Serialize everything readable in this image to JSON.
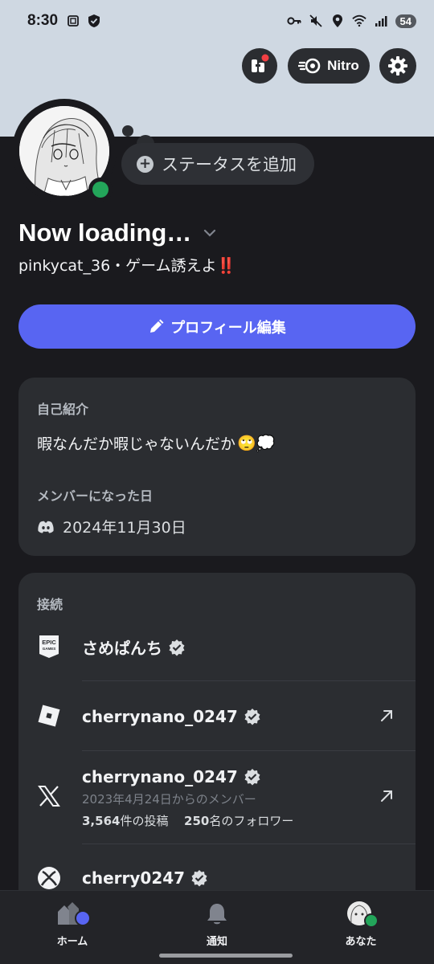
{
  "status_bar": {
    "time": "8:30",
    "battery": "54"
  },
  "header": {
    "nitro_label": "Nitro",
    "status_placeholder": "ステータスを追加"
  },
  "profile": {
    "display_name": "Now loading…",
    "username_line": "pinkycat_36・ゲーム誘えよ",
    "username_emoji": "‼️",
    "online_status": "online"
  },
  "actions": {
    "edit_profile_label": "プロフィール編集"
  },
  "about": {
    "heading": "自己紹介",
    "text": "暇なんだか暇じゃないんだか",
    "text_emoji": "🙄💭",
    "member_since_heading": "メンバーになった日",
    "member_since_date": "2024年11月30日"
  },
  "connections": {
    "heading": "接続",
    "items": [
      {
        "service": "Epic Games",
        "icon": "epic-games-icon",
        "name": "さめぱんち",
        "verified": true,
        "external": false
      },
      {
        "service": "Roblox",
        "icon": "roblox-icon",
        "name": "cherrynano_0247",
        "verified": true,
        "external": true
      },
      {
        "service": "X",
        "icon": "x-icon",
        "name": "cherrynano_0247",
        "verified": true,
        "external": true,
        "member_since": "2023年4月24日からのメンバー",
        "posts_count": "3,564",
        "posts_label": "件の投稿",
        "followers_count": "250",
        "followers_label": "名のフォロワー"
      },
      {
        "service": "Xbox",
        "icon": "xbox-icon",
        "name": "cherry0247",
        "verified": true,
        "external": false
      }
    ]
  },
  "bottom_nav": {
    "home_label": "ホーム",
    "notifications_label": "通知",
    "you_label": "あなた"
  },
  "colors": {
    "background": "#1a1a1e",
    "card": "#2b2d31",
    "brand": "#5865f2",
    "online": "#23a55a",
    "banner": "#cfd8e2"
  }
}
